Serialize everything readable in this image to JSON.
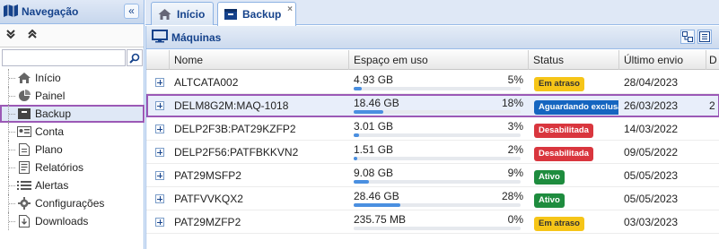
{
  "sidebar": {
    "title": "Navegação",
    "collapse_icon": "double-chevron-left-icon",
    "expand_all_icon": "double-chevron-down-icon",
    "collapse_all_icon": "double-chevron-up-icon",
    "search": {
      "value": "",
      "placeholder": ""
    },
    "items": [
      {
        "label": "Início",
        "icon": "home-icon"
      },
      {
        "label": "Painel",
        "icon": "pie-chart-icon"
      },
      {
        "label": "Backup",
        "icon": "backup-box-icon",
        "selected": true
      },
      {
        "label": "Conta",
        "icon": "id-card-icon"
      },
      {
        "label": "Plano",
        "icon": "document-icon"
      },
      {
        "label": "Relatórios",
        "icon": "report-icon"
      },
      {
        "label": "Alertas",
        "icon": "alert-list-icon"
      },
      {
        "label": "Configurações",
        "icon": "gear-icon"
      },
      {
        "label": "Downloads",
        "icon": "download-icon"
      }
    ]
  },
  "tabs": [
    {
      "label": "Início",
      "icon": "home-icon"
    },
    {
      "label": "Backup",
      "icon": "backup-box-icon",
      "active": true,
      "close": "×"
    }
  ],
  "panel": {
    "title": "Máquinas",
    "icon": "monitor-icon"
  },
  "grid": {
    "columns": [
      "Nome",
      "Espaço em uso",
      "Status",
      "Último envio",
      "D"
    ],
    "rows": [
      {
        "name": "ALTCATA002",
        "space": "4.93 GB",
        "pct": "5%",
        "fill": 0.05,
        "status": "Em atraso",
        "status_kind": "delayed",
        "last": "28/04/2023",
        "extra": ""
      },
      {
        "name": "DELM8G2M:MAQ-1018",
        "space": "18.46 GB",
        "pct": "18%",
        "fill": 0.18,
        "status": "Aguardando exclusão",
        "status_kind": "pending",
        "last": "26/03/2023",
        "extra": "2",
        "selected": true
      },
      {
        "name": "DELP2F3B:PAT29KZFP2",
        "space": "3.01 GB",
        "pct": "3%",
        "fill": 0.03,
        "status": "Desabilitada",
        "status_kind": "disabled",
        "last": "14/03/2022",
        "extra": ""
      },
      {
        "name": "DELP2F56:PATFBKKVN2",
        "space": "1.51 GB",
        "pct": "2%",
        "fill": 0.02,
        "status": "Desabilitada",
        "status_kind": "disabled",
        "last": "09/05/2022",
        "extra": ""
      },
      {
        "name": "PAT29MSFP2",
        "space": "9.08 GB",
        "pct": "9%",
        "fill": 0.09,
        "status": "Ativo",
        "status_kind": "active",
        "last": "05/05/2023",
        "extra": ""
      },
      {
        "name": "PATFVVKQX2",
        "space": "28.46 GB",
        "pct": "28%",
        "fill": 0.28,
        "status": "Ativo",
        "status_kind": "active",
        "last": "05/05/2023",
        "extra": ""
      },
      {
        "name": "PAT29MZFP2",
        "space": "235.75 MB",
        "pct": "0%",
        "fill": 0.0,
        "status": "Em atraso",
        "status_kind": "delayed",
        "last": "03/03/2023",
        "extra": ""
      }
    ]
  },
  "colors": {
    "accent": "#15428b",
    "header_bg": "#dfe8f6",
    "selection_outline": "#9b59b6",
    "bar": "#4a8fe0"
  }
}
